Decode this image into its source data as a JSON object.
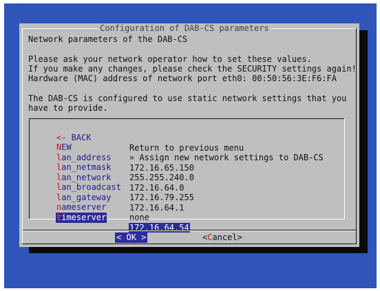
{
  "dialog": {
    "title": "Configuration of DAB-CS parameters",
    "lines": [
      "Network parameters of the DAB-CS",
      "",
      "Please ask your network operator how to set these values.",
      "If you make any changes, please check the SECURITY settings again!",
      "Hardware (MAC) address of network port eth0: 00:50:56:3E:F6:FA",
      "",
      "The DAB-CS is configured to use static network settings that you",
      "have to provide."
    ]
  },
  "menu": {
    "items": [
      {
        "hot": "<",
        "rest": "- BACK",
        "desc": "Return to previous menu",
        "selected": false
      },
      {
        "hot": "N",
        "rest": "EW",
        "desc": "» Assign new network settings to DAB-CS",
        "selected": false
      },
      {
        "hot": "l",
        "rest": "an_address",
        "desc": "172.16.65.150",
        "selected": false
      },
      {
        "hot": "l",
        "rest": "an_netmask",
        "desc": "255.255.240.0",
        "selected": false
      },
      {
        "hot": "l",
        "rest": "an_network",
        "desc": "172.16.64.0",
        "selected": false
      },
      {
        "hot": "l",
        "rest": "an_broadcast",
        "desc": "172.16.79.255",
        "selected": false
      },
      {
        "hot": "l",
        "rest": "an_gateway",
        "desc": "172.16.64.1",
        "selected": false
      },
      {
        "hot": "n",
        "rest": "ameserver",
        "desc": "none",
        "selected": false
      },
      {
        "hot": "t",
        "rest": "imeserver",
        "desc": "172.16.64.54",
        "selected": true
      }
    ]
  },
  "buttons": {
    "ok": {
      "left": "<",
      "hot": " ",
      "label": "OK",
      "right": " >"
    },
    "cancel": {
      "left": "<",
      "hot": "C",
      "label": "ancel",
      "right": ">"
    }
  },
  "colors": {
    "background": "#2f55b8",
    "dialog": "#bfbfbf",
    "highlight": "#2c2c9a",
    "hotkey": "#c01818",
    "tag": "#1d1d8c"
  }
}
